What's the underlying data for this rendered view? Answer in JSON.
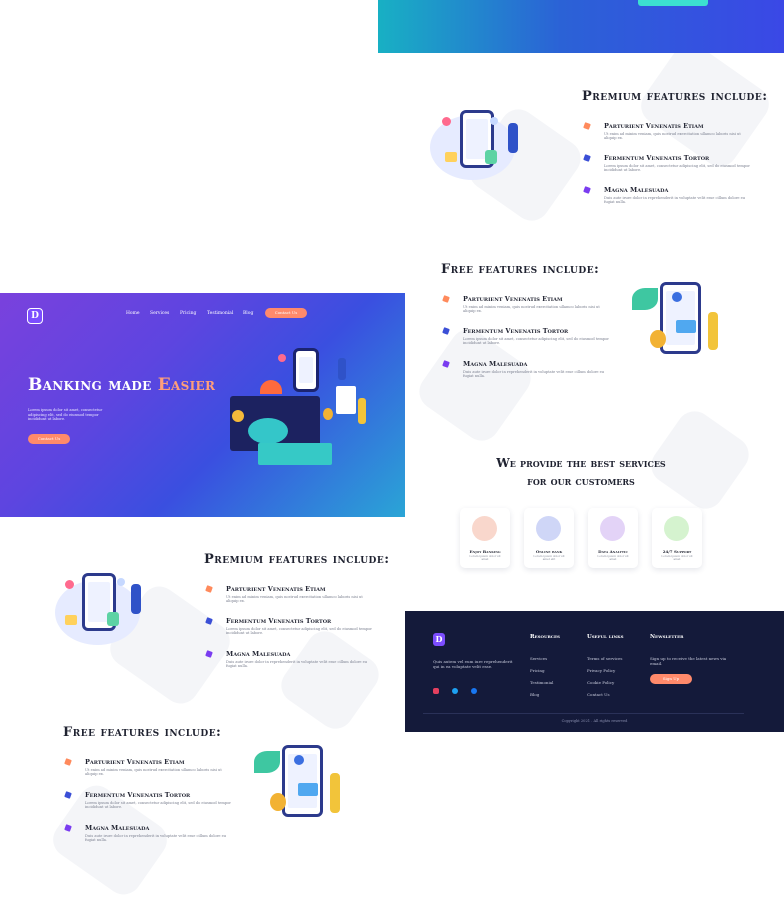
{
  "hero": {
    "logo": "D",
    "nav": [
      "Home",
      "Services",
      "Pricing",
      "Testimonial",
      "Blog"
    ],
    "cta": "Contact Us",
    "title_main": "Banking made ",
    "title_accent": "Easier",
    "subtitle": "Lorem ipsum dolor sit amet, consectetur adipiscing elit, sed do eiusmod tempor incididunt ut labore.",
    "button": "Contact Us"
  },
  "premium": {
    "title": "Premium features include:",
    "items": [
      {
        "heading": "Parturient Venenatis Etiam",
        "text": "Ut enim ad minim veniam, quis nostrud exercitation ullamco laboris nisi ut aliquip ex."
      },
      {
        "heading": "Fermentum Venenatis Tortor",
        "text": "Lorem ipsum dolor sit amet, consectetur adipiscing elit, sed do eiusmod tempor incididunt ut labore."
      },
      {
        "heading": "Magna Malesuada",
        "text": "Duis aute irure dolor in reprehenderit in voluptate velit esse cillum dolore eu fugiat nulla."
      }
    ]
  },
  "free": {
    "title": "Free features include:",
    "items": [
      {
        "heading": "Parturient Venenatis Etiam",
        "text": "Ut enim ad minim veniam, quis nostrud exercitation ullamco laboris nisi ut aliquip ex."
      },
      {
        "heading": "Fermentum Venenatis Tortor",
        "text": "Lorem ipsum dolor sit amet, consectetur adipiscing elit, sed do eiusmod tempor incididunt ut labore."
      },
      {
        "heading": "Magna Malesuada",
        "text": "Duis aute irure dolor in reprehenderit in voluptate velit esse cillum dolore eu fugiat nulla."
      }
    ]
  },
  "services": {
    "title_line1": "We provide the best services",
    "title_line2": "for our customers",
    "cards": [
      {
        "name": "Enjoy Banking",
        "text": "Lorem ipsum dolor sit amet",
        "color": "#f9d7cc",
        "icon": "play-icon"
      },
      {
        "name": "Online bank",
        "text": "Lorem ipsum dolor sit amet elit",
        "color": "#cfd6f7",
        "icon": "folder-icon"
      },
      {
        "name": "Data Analytic",
        "text": "Lorem ipsum dolor sit amet",
        "color": "#e3d3f7",
        "icon": "pie-chart-icon"
      },
      {
        "name": "24/7 Support",
        "text": "Lorem ipsum dolor sit amet",
        "color": "#d5f3cf",
        "icon": "support-icon"
      }
    ]
  },
  "footer": {
    "logo": "D",
    "description": "Quis autem vel eum iure reprehenderit qui in ea voluptate velit esse.",
    "columns": [
      {
        "heading": "Resources",
        "links": [
          "Services",
          "Pricing",
          "Testimonial",
          "Blog"
        ]
      },
      {
        "heading": "Useful links",
        "links": [
          "Terms of services",
          "Privacy Policy",
          "Cookie Policy",
          "Contact Us"
        ]
      }
    ],
    "newsletter_heading": "Newsletter",
    "newsletter_text": "Sign up to receive the latest news via email.",
    "subscribe": "Sign Up",
    "copyright": "Copyright 2021 . All rights reserved"
  },
  "colors": {
    "accent": "#ff8a6b",
    "brand": "#7c4dff",
    "footer_bg": "#141a3a",
    "icon_orange": "#ff8a5c",
    "icon_blue": "#3b4fd6",
    "icon_purple": "#7a3cf0"
  }
}
